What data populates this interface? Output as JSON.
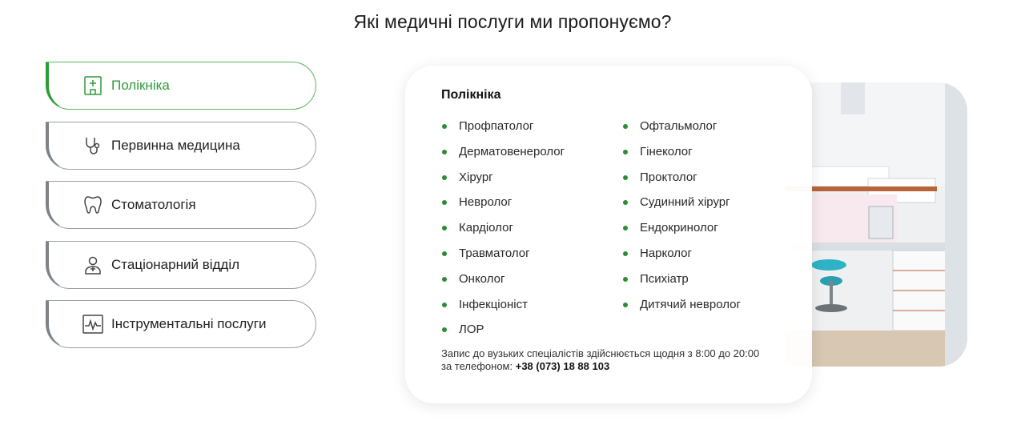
{
  "page_title": "Які медичні послуги ми пропонуємо?",
  "tabs": [
    {
      "label": "Полікніка",
      "icon": "hospital-icon",
      "active": true
    },
    {
      "label": "Первинна медицина",
      "icon": "stethoscope-icon",
      "active": false
    },
    {
      "label": "Стоматологія",
      "icon": "tooth-icon",
      "active": false
    },
    {
      "label": "Стаціонарний відділ",
      "icon": "doctor-icon",
      "active": false
    },
    {
      "label": "Інструментальні послуги",
      "icon": "cardiogram-icon",
      "active": false
    }
  ],
  "panel": {
    "title": "Полікніка",
    "left_list": [
      "Профпатолог",
      "Дерматовенеролог",
      "Хірург",
      "Невролог",
      "Кардіолог",
      "Травматолог",
      "Онколог",
      "Інфекціоніст",
      "ЛОР"
    ],
    "right_list": [
      "Офтальмолог",
      "Гінеколог",
      "Проктолог",
      "Судинний хірург",
      "Ендокринолог",
      "Нарколог",
      "Психіатр",
      "Дитячий невролог"
    ],
    "note_text": "Запис до вузьких спеціалістів здійснюється щодня з 8:00 до 20:00 за телефоном: ",
    "phone": "+38 (073) 18 88 103"
  },
  "colors": {
    "accent": "#2e9b3a",
    "bullet": "#2e8b35",
    "border": "#9aa0a6"
  }
}
